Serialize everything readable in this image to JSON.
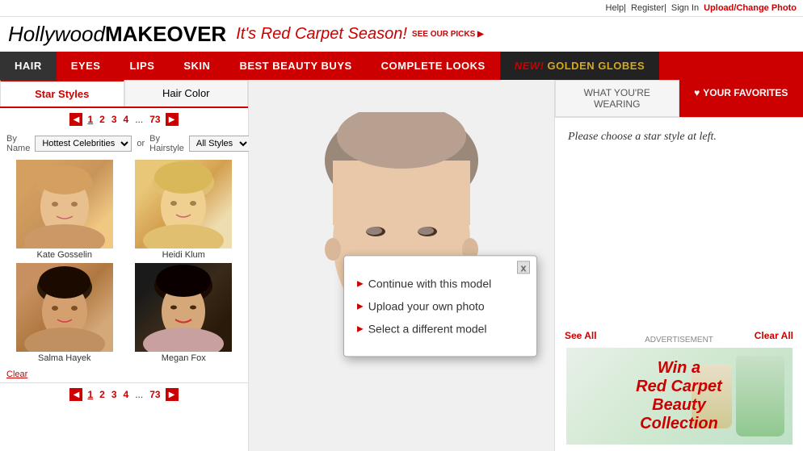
{
  "topbar": {
    "help": "Help",
    "separator1": "|",
    "register": "Register",
    "separator2": "|",
    "sign_in": "Sign In",
    "upload": "Upload/Change Photo"
  },
  "header": {
    "logo_hollywood": "Hollywood",
    "logo_makeover": "MAKEOVER",
    "tagline": "It's Red Carpet Season!",
    "see_picks": "SEE OUR PICKS ▶"
  },
  "nav": {
    "items": [
      {
        "label": "HAIR",
        "active": true
      },
      {
        "label": "EYES",
        "active": false
      },
      {
        "label": "LIPS",
        "active": false
      },
      {
        "label": "SKIN",
        "active": false
      },
      {
        "label": "BEST BEAUTY BUYS",
        "active": false
      },
      {
        "label": "COMPLETE LOOKS",
        "active": false
      }
    ],
    "golden_item": "NEW! GOLDEN GLOBES",
    "new_tag": "NEW!"
  },
  "left_panel": {
    "tab_star_styles": "Star Styles",
    "tab_hair_color": "Hair Color",
    "pagination": {
      "current": "1",
      "pages": [
        "1",
        "2",
        "3",
        "4",
        "...",
        "73"
      ],
      "prev_label": "◀",
      "next_label": "▶"
    },
    "filter_by_name_label": "By Name",
    "filter_by_hairstyle_label": "By Hairstyle",
    "dropdown_name_default": "Hottest Celebrities",
    "dropdown_or": "or",
    "dropdown_hairstyle_default": "All Styles",
    "stars": [
      {
        "name": "Kate Gosselin",
        "color_class": "kate-photo"
      },
      {
        "name": "Heidi Klum",
        "color_class": "heidi-photo"
      },
      {
        "name": "Salma Hayek",
        "color_class": "salma-photo"
      },
      {
        "name": "Megan Fox",
        "color_class": "megan-photo"
      }
    ],
    "clear_label": "Clear",
    "bottom_pagination": {
      "current": "1",
      "pages": [
        "1",
        "2",
        "3",
        "4",
        "...",
        "73"
      ]
    }
  },
  "popup": {
    "close_label": "x",
    "options": [
      "Continue with this model",
      "Upload your own photo",
      "Select a different model"
    ]
  },
  "right_panel": {
    "tab_what_wearing": "WHAT YOU'RE WEARING",
    "tab_favorites": "♥ YOUR FAVORITES",
    "empty_message": "Please choose a star style at left.",
    "see_all": "See All",
    "clear_all": "Clear All",
    "ad_label": "ADVERTISEMENT",
    "ad_text": "Win a\nRed Carpet\nBeauty\nCollecti..."
  }
}
